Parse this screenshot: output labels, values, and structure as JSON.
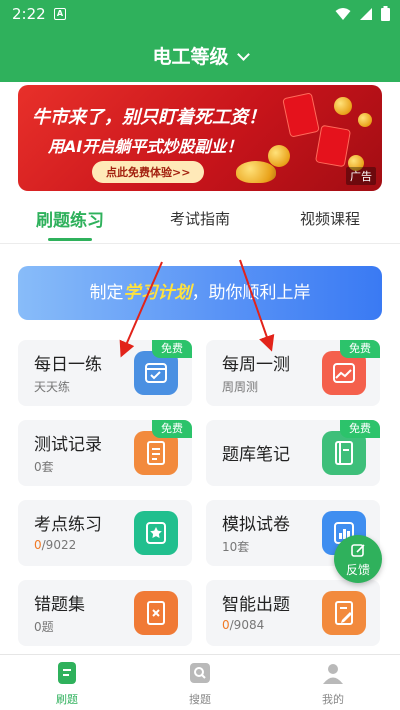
{
  "status_bar": {
    "time": "2:22",
    "notification_glyph": "A"
  },
  "header": {
    "title": "电工等级"
  },
  "ad": {
    "headline": "牛市来了，别只盯着死工资！",
    "subline": "用AI开启躺平式炒股副业！",
    "cta": "点此免费体验>>",
    "tag": "广告"
  },
  "tabs": [
    {
      "label": "刷题练习",
      "active": true
    },
    {
      "label": "考试指南",
      "active": false
    },
    {
      "label": "视频课程",
      "active": false
    }
  ],
  "plan_banner": {
    "prefix": "制定",
    "highlight": "学习计划",
    "suffix": "，助你顺利上岸"
  },
  "cards": [
    {
      "title": "每日一练",
      "subtitle": "天天练",
      "badge": "免费",
      "icon": "calendar-check-icon",
      "color": "#4a90e2"
    },
    {
      "title": "每周一测",
      "subtitle": "周周测",
      "badge": "免费",
      "icon": "image-chart-icon",
      "color": "#f4604c"
    },
    {
      "title": "测试记录",
      "subtitle": "0套",
      "badge": "免费",
      "icon": "document-list-icon",
      "color": "#f28a3d"
    },
    {
      "title": "题库笔记",
      "subtitle": "",
      "badge": "免费",
      "icon": "notebook-icon",
      "color": "#3ebf7a"
    },
    {
      "title": "考点练习",
      "subtitle_done": "0",
      "subtitle_total": "/9022",
      "icon": "star-document-icon",
      "color": "#21bf8e"
    },
    {
      "title": "模拟试卷",
      "subtitle": "10套",
      "icon": "bar-chart-icon",
      "color": "#3f8ef0"
    },
    {
      "title": "错题集",
      "subtitle": "0题",
      "icon": "wrong-document-icon",
      "color": "#f07a36"
    },
    {
      "title": "智能出题",
      "subtitle_done": "0",
      "subtitle_total": "/9084",
      "icon": "edit-document-icon",
      "color": "#f28a3d"
    }
  ],
  "feedback": {
    "label": "反馈"
  },
  "bottom_nav": [
    {
      "label": "刷题",
      "icon": "document-icon",
      "active": true
    },
    {
      "label": "搜题",
      "icon": "search-icon",
      "active": false
    },
    {
      "label": "我的",
      "icon": "user-icon",
      "active": false
    }
  ]
}
